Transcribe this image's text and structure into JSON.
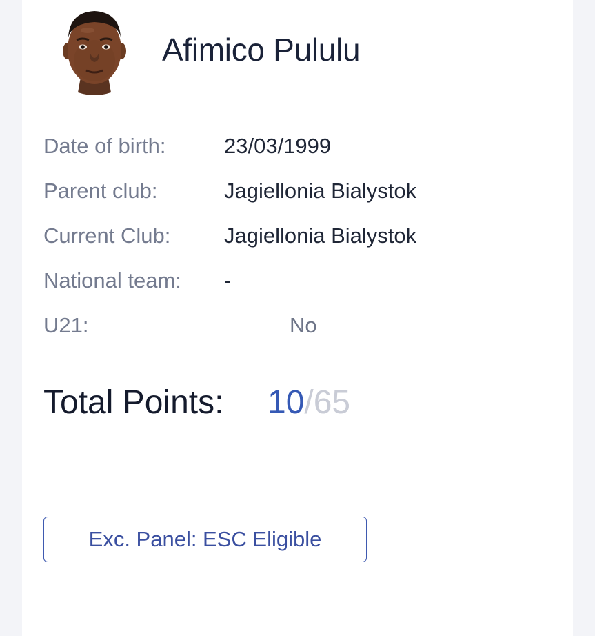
{
  "player": {
    "name": "Afimico Pululu",
    "avatar_icon": "player-portrait"
  },
  "details": [
    {
      "label": "Date of birth:",
      "value": "23/03/1999"
    },
    {
      "label": "Parent club:",
      "value": "Jagiellonia Bialystok"
    },
    {
      "label": "Current Club:",
      "value": "Jagiellonia Bialystok"
    },
    {
      "label": "National team:",
      "value": "-"
    },
    {
      "label": "U21:",
      "value": "No"
    }
  ],
  "points": {
    "label": "Total Points:",
    "current": "10",
    "separator": "/",
    "max": "65"
  },
  "eligibility_button": {
    "label": "Exc. Panel: ESC Eligible"
  },
  "colors": {
    "accent": "#3559b5",
    "muted": "#c9ccd6",
    "label": "#747b8f",
    "text": "#1f2636",
    "background": "#f3f4f8"
  }
}
